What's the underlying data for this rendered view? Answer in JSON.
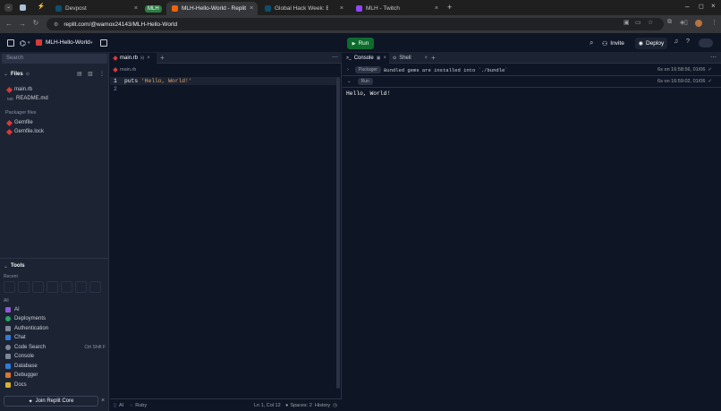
{
  "browser": {
    "tabs": [
      {
        "label": "Devpost",
        "favicon_color": "#003e54",
        "favicon_text": "D"
      },
      {
        "label": "MLH",
        "favicon_color": "#2d7d46"
      },
      {
        "label": "MLH-Hello-World - Replit",
        "favicon_color": "#f26207"
      },
      {
        "label": "Global Hack Week: Begi",
        "favicon_color": "#003e54",
        "favicon_text": "D"
      },
      {
        "label": "MLH - Twitch",
        "favicon_color": "#9146ff"
      }
    ],
    "url": "replit.com/@wamox24143/MLH-Hello-World"
  },
  "topbar": {
    "repl_name": "MLH-Hello-World",
    "run_label": "Run",
    "invite_label": "Invite",
    "deploy_label": "Deploy"
  },
  "sidebar": {
    "search_placeholder": "Search",
    "files_header": "Files",
    "files": [
      {
        "name": "main.rb",
        "icon": "ruby-icon"
      },
      {
        "name": "README.md",
        "icon": "markdown-icon"
      }
    ],
    "packager_header": "Packager files",
    "packager_files": [
      {
        "name": "Gemfile",
        "icon": "ruby-icon"
      },
      {
        "name": "Gemfile.lock",
        "icon": "ruby-icon"
      }
    ],
    "tools_header": "Tools",
    "recent_label": "Recent",
    "all_label": "All",
    "tools": [
      {
        "label": "AI",
        "color": "#8e5ad9",
        "shortcut": ""
      },
      {
        "label": "Deployments",
        "color": "#2aa565",
        "shortcut": ""
      },
      {
        "label": "Authentication",
        "color": "#7d8799",
        "shortcut": ""
      },
      {
        "label": "Chat",
        "color": "#2f7bd6",
        "shortcut": ""
      },
      {
        "label": "Code Search",
        "color": "#7d8799",
        "shortcut": "Ctrl Shift F"
      },
      {
        "label": "Console",
        "color": "#7d8799",
        "shortcut": ""
      },
      {
        "label": "Database",
        "color": "#2f7bd6",
        "shortcut": ""
      },
      {
        "label": "Debugger",
        "color": "#d6792f",
        "shortcut": ""
      },
      {
        "label": "Docs",
        "color": "#d6b02f",
        "shortcut": ""
      }
    ],
    "join_core": "Join Replit Core"
  },
  "editor": {
    "tab_label": "main.rb",
    "breadcrumb": "main.rb",
    "lines": [
      {
        "num": "1",
        "kw": "puts",
        "str": "'Hello, World!'"
      },
      {
        "num": "2",
        "kw": "",
        "str": ""
      }
    ],
    "status": {
      "ai": "AI",
      "lang": "Ruby",
      "position": "Ln 1, Col 12",
      "spaces": "Spaces: 2",
      "history": "History"
    }
  },
  "console": {
    "tabs": [
      {
        "label": "Console"
      },
      {
        "label": "Shell"
      }
    ],
    "rows": [
      {
        "tag": "Packager",
        "text": "Bundled gems are installed into `./bundle`",
        "time": "6s on 16:58:56, 01/06"
      },
      {
        "tag": "Run",
        "text": "",
        "time": "6s on 16:59:02, 01/06"
      }
    ],
    "output": "Hello, World!"
  }
}
